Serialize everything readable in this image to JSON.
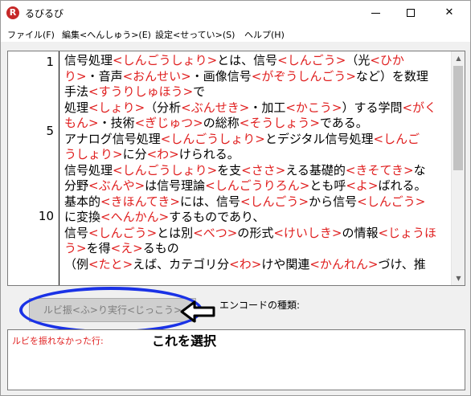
{
  "window": {
    "title": "るびるび",
    "app_icon": "R"
  },
  "menu": [
    "ファイル(F)",
    "編集<へんしゅう>(E)",
    "設定<せってい>(S)",
    "ヘルプ(H)"
  ],
  "gutter": {
    "line_numbers": [
      "1",
      "5",
      "10"
    ]
  },
  "editor_lines": [
    [
      [
        "t",
        "信号処理"
      ],
      [
        "r",
        "<しんごうしょり>"
      ],
      [
        "t",
        "とは、信号"
      ],
      [
        "r",
        "<しんごう>"
      ],
      [
        "t",
        "（光"
      ],
      [
        "r",
        "<ひか"
      ]
    ],
    [
      [
        "r",
        "り>"
      ],
      [
        "t",
        "・音声"
      ],
      [
        "r",
        "<おんせい>"
      ],
      [
        "t",
        "・画像信号"
      ],
      [
        "r",
        "<がぞうしんごう>"
      ],
      [
        "t",
        "など）を数理"
      ]
    ],
    [
      [
        "t",
        "手法"
      ],
      [
        "r",
        "<すうりしゅほう>"
      ],
      [
        "t",
        "で"
      ]
    ],
    [
      [
        "t",
        "処理"
      ],
      [
        "r",
        "<しょり>"
      ],
      [
        "t",
        "（分析"
      ],
      [
        "r",
        "<ぶんせき>"
      ],
      [
        "t",
        "・加工"
      ],
      [
        "r",
        "<かこう>"
      ],
      [
        "t",
        "）する学問"
      ],
      [
        "r",
        "<がく"
      ]
    ],
    [
      [
        "r",
        "もん>"
      ],
      [
        "t",
        "・技術"
      ],
      [
        "r",
        "<ぎじゅつ>"
      ],
      [
        "t",
        "の総称"
      ],
      [
        "r",
        "<そうしょう>"
      ],
      [
        "t",
        "である。"
      ]
    ],
    [
      [
        "t",
        "アナログ信号処理"
      ],
      [
        "r",
        "<しんごうしょり>"
      ],
      [
        "t",
        "とデジタル信号処理"
      ],
      [
        "r",
        "<しんご"
      ]
    ],
    [
      [
        "r",
        "うしょり>"
      ],
      [
        "t",
        "に分"
      ],
      [
        "r",
        "<わ>"
      ],
      [
        "t",
        "けられる。"
      ]
    ],
    [
      [
        "t",
        "信号処理"
      ],
      [
        "r",
        "<しんごうしょり>"
      ],
      [
        "t",
        "を支"
      ],
      [
        "r",
        "<ささ>"
      ],
      [
        "t",
        "える基礎的"
      ],
      [
        "r",
        "<きそてき>"
      ],
      [
        "t",
        "な"
      ]
    ],
    [
      [
        "t",
        "分野"
      ],
      [
        "r",
        "<ぶんや>"
      ],
      [
        "t",
        "は信号理論"
      ],
      [
        "r",
        "<しんごうりろん>"
      ],
      [
        "t",
        "とも呼"
      ],
      [
        "r",
        "<よ>"
      ],
      [
        "t",
        "ばれる。"
      ]
    ],
    [
      [
        "t",
        "基本的"
      ],
      [
        "r",
        "<きほんてき>"
      ],
      [
        "t",
        "には、信号"
      ],
      [
        "r",
        "<しんごう>"
      ],
      [
        "t",
        "から信号"
      ],
      [
        "r",
        "<しんごう>"
      ]
    ],
    [
      [
        "t",
        "に変換"
      ],
      [
        "r",
        "<へんかん>"
      ],
      [
        "t",
        "するものであり、"
      ]
    ],
    [
      [
        "t",
        "信号"
      ],
      [
        "r",
        "<しんごう>"
      ],
      [
        "t",
        "とは別"
      ],
      [
        "r",
        "<べつ>"
      ],
      [
        "t",
        "の形式"
      ],
      [
        "r",
        "<けいしき>"
      ],
      [
        "t",
        "の情報"
      ],
      [
        "r",
        "<じょうほ"
      ]
    ],
    [
      [
        "r",
        "う>"
      ],
      [
        "t",
        "を得"
      ],
      [
        "r",
        "<え>"
      ],
      [
        "t",
        "るもの"
      ]
    ],
    [
      [
        "t",
        "（例"
      ],
      [
        "r",
        "<たと>"
      ],
      [
        "t",
        "えば、カテゴリ分"
      ],
      [
        "r",
        "<わ>"
      ],
      [
        "t",
        "けや関連"
      ],
      [
        "r",
        "<かんれん>"
      ],
      [
        "t",
        "づけ、推"
      ]
    ]
  ],
  "colors": {
    "ruby": "#e02020",
    "highlight_ring": "#1a32e6"
  },
  "run_button": {
    "label": "ルビ振<ふ>り実行<じっこう>"
  },
  "encoding": {
    "label": "エンコードの種類:"
  },
  "annotation": {
    "callout": "これを選択",
    "arrow_icon": "left-arrow-icon"
  },
  "result": {
    "label": "ルビを振れなかった行:"
  }
}
